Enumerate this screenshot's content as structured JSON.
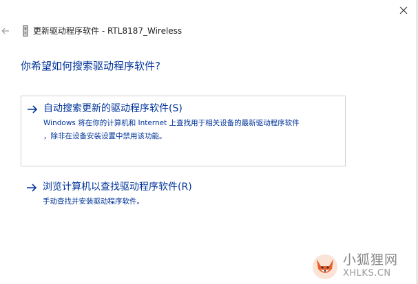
{
  "window": {
    "title": "更新驱动程序软件 - RTL8187_Wireless",
    "close_icon": "close-icon",
    "back_icon": "back-arrow-icon",
    "device_icon": "device-icon"
  },
  "heading": "你希望如何搜索驱动程序软件?",
  "options": [
    {
      "title": "自动搜索更新的驱动程序软件(S)",
      "description": "Windows 将在你的计算机和 Internet 上查找用于相关设备的最新驱动程序软件\n，除非在设备安装设置中禁用该功能。",
      "icon": "arrow-right-icon"
    },
    {
      "title": "浏览计算机以查找驱动程序软件(R)",
      "description": "手动查找并安装驱动程序软件。",
      "icon": "arrow-right-icon"
    }
  ],
  "watermark": {
    "name": "小狐狸网",
    "domain": "XHLKS.CN"
  },
  "colors": {
    "link_blue": "#003399",
    "border": "#cfcfcf",
    "watermark_gray": "#888888",
    "fox_orange": "#e8602c"
  }
}
